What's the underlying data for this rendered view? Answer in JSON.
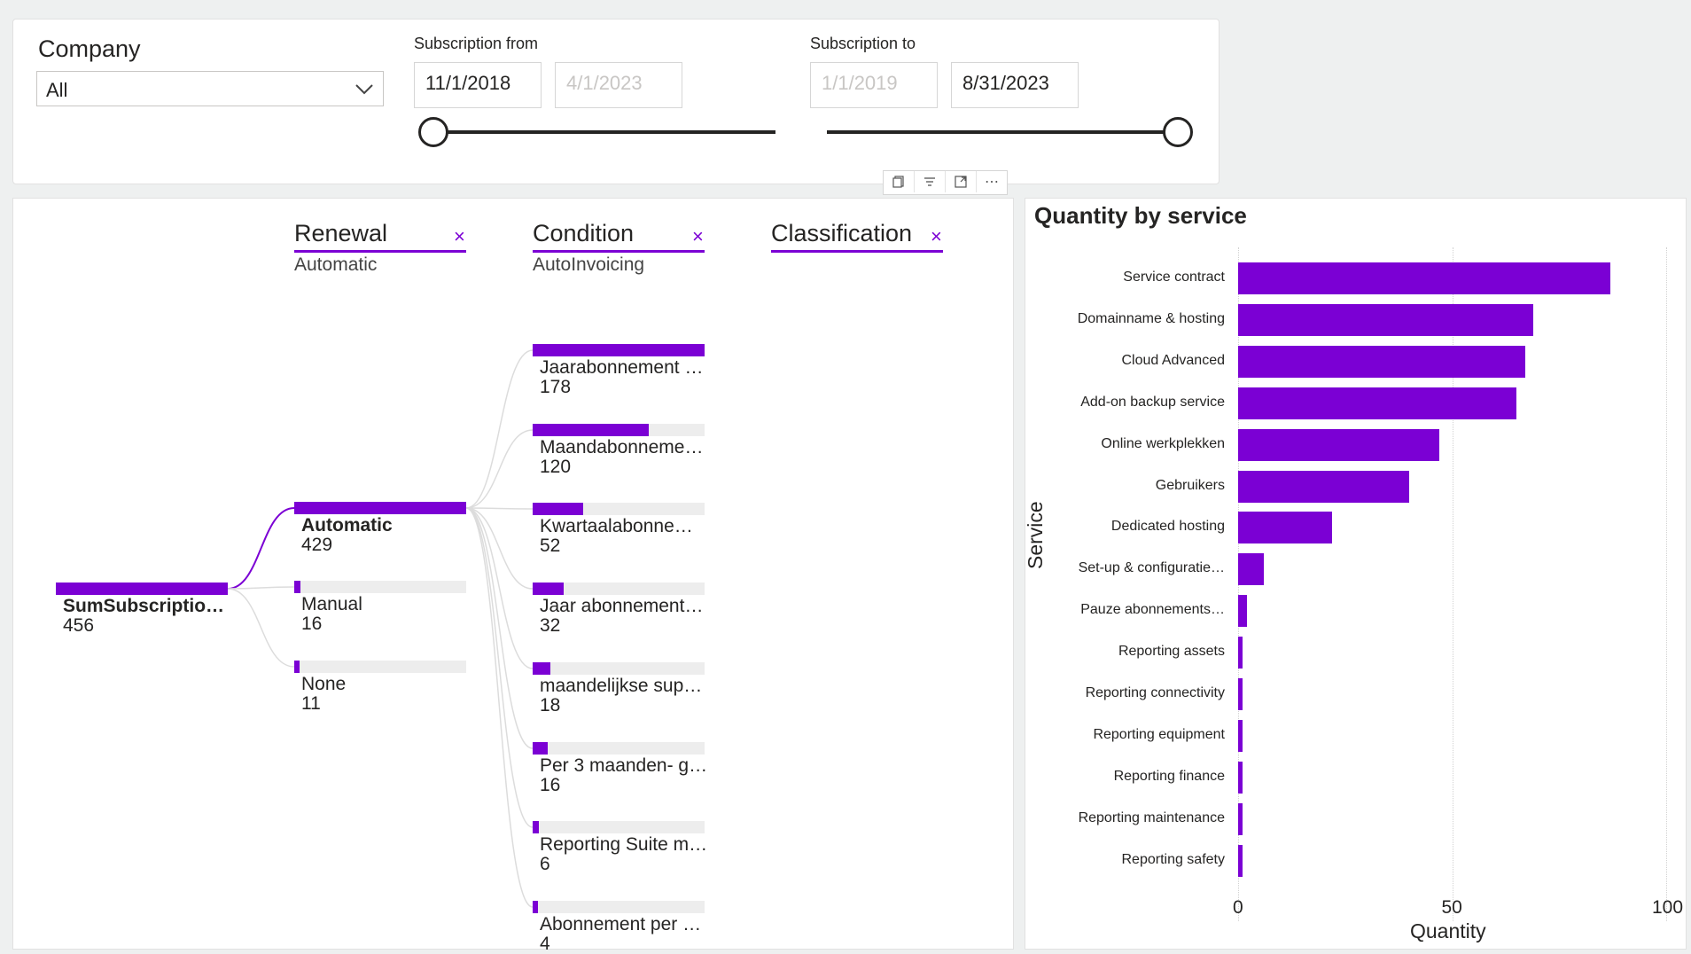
{
  "filters": {
    "company": {
      "label": "Company",
      "value": "All"
    },
    "subscription_from": {
      "label": "Subscription from",
      "start": "11/1/2018",
      "end": "4/1/2023"
    },
    "subscription_to": {
      "label": "Subscription to",
      "start": "1/1/2019",
      "end": "8/31/2023"
    }
  },
  "visual_header": {
    "icons": [
      "copy-icon",
      "filter-icon",
      "focus-mode-icon",
      "more-options-icon"
    ],
    "more_glyph": "⋯"
  },
  "decomposition_tree": {
    "levels": [
      {
        "title": "Renewal",
        "selected": "Automatic",
        "close": "×"
      },
      {
        "title": "Condition",
        "selected": "AutoInvoicing",
        "close": "×"
      },
      {
        "title": "Classification",
        "selected": "",
        "close": "×"
      }
    ],
    "root": {
      "label": "SumSubscriptio…",
      "value": "456",
      "fraction": 1.0
    },
    "renewal": [
      {
        "label": "Automatic",
        "value": "429",
        "fraction": 1.0
      },
      {
        "label": "Manual",
        "value": "16",
        "fraction": 0.037
      },
      {
        "label": "None",
        "value": "11",
        "fraction": 0.026
      }
    ],
    "condition": [
      {
        "label": "Jaarabonnement …",
        "value": "178",
        "fraction": 1.0
      },
      {
        "label": "Maandabonneme…",
        "value": "120",
        "fraction": 0.674
      },
      {
        "label": "Kwartaalabonne…",
        "value": "52",
        "fraction": 0.292
      },
      {
        "label": "Jaar abonnement…",
        "value": "32",
        "fraction": 0.18
      },
      {
        "label": "maandelijkse sup…",
        "value": "18",
        "fraction": 0.101
      },
      {
        "label": "Per 3 maanden- g…",
        "value": "16",
        "fraction": 0.09
      },
      {
        "label": "Reporting Suite m…",
        "value": "6",
        "fraction": 0.034
      },
      {
        "label": "Abonnement per …",
        "value": "4",
        "fraction": 0.022
      }
    ]
  },
  "chart_data": {
    "type": "bar",
    "orientation": "horizontal",
    "title": "Quantity by service",
    "xlabel": "Quantity",
    "ylabel": "Service",
    "xlim": [
      0,
      100
    ],
    "xticks": [
      "0",
      "50",
      "100"
    ],
    "categories": [
      "Service contract",
      "Domainname & hosting",
      "Cloud Advanced",
      "Add-on backup service",
      "Online werkplekken",
      "Gebruikers",
      "Dedicated hosting",
      "Set-up & configuratie…",
      "Pauze abonnements…",
      "Reporting assets",
      "Reporting connectivity",
      "Reporting equipment",
      "Reporting finance",
      "Reporting maintenance",
      "Reporting safety"
    ],
    "values": [
      87,
      69,
      67,
      65,
      47,
      40,
      22,
      6,
      2,
      1,
      1,
      1,
      1,
      1,
      1
    ],
    "color": "#7b00d4",
    "grid": true
  }
}
